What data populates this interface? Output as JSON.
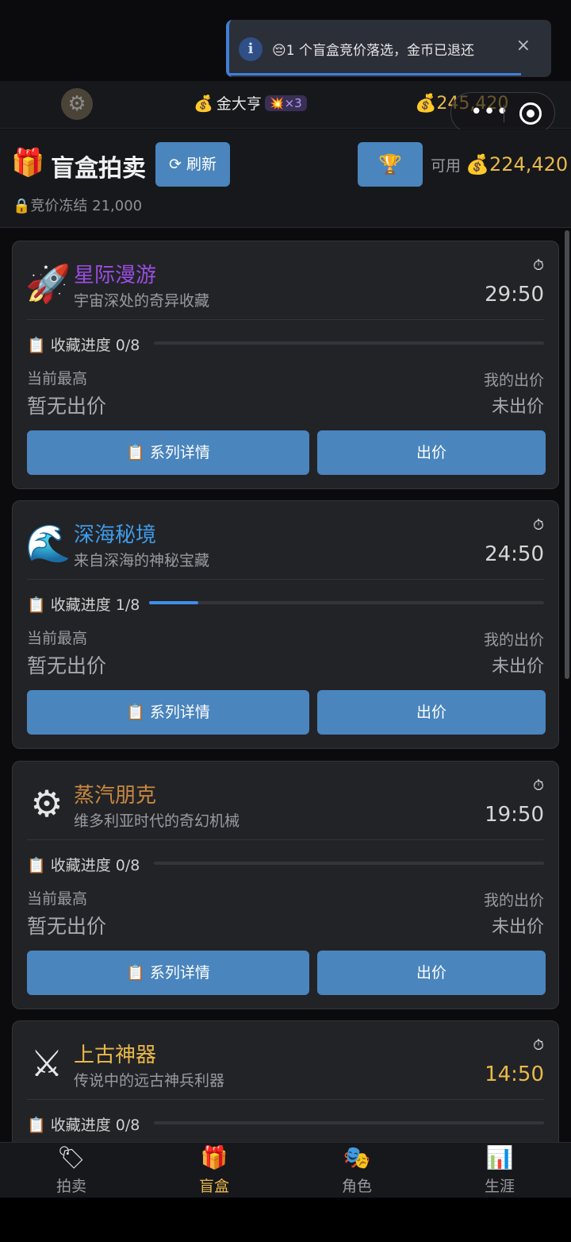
{
  "toast": {
    "icon": "info-icon",
    "message": "😔1 个盲盒竞价落选，金币已退还",
    "close": "×"
  },
  "topbar": {
    "settings_icon": "⚙",
    "avatar_icon": "💰",
    "username": "金大亨",
    "combo": "💥×3",
    "coins": "💰245,420",
    "more": "•••"
  },
  "header": {
    "title_icon": "🎁",
    "title": "盲盒拍卖",
    "refresh_label": "⟳ 刷新",
    "trophy_icon": "🏆",
    "available_label": "可用",
    "available_amount": "💰224,420",
    "frozen": "🔒竞价冻结 21,000"
  },
  "labels": {
    "progress_prefix": "📋 收藏进度",
    "current_high": "当前最高",
    "no_bid": "暂无出价",
    "my_bid": "我的出价",
    "not_bid": "未出价",
    "detail_btn": "📋 系列详情",
    "bid_btn": "出价",
    "timer_icon": "⏱"
  },
  "cards": [
    {
      "icon": "🚀",
      "name": "星际漫游",
      "name_color": "#9b4de0",
      "desc": "宇宙深处的奇异收藏",
      "time": "29:50",
      "time_color": "#d6d6d6",
      "progress": "0/8",
      "progress_fraction": 0
    },
    {
      "icon": "🌊",
      "name": "深海秘境",
      "name_color": "#3f9be8",
      "desc": "来自深海的神秘宝藏",
      "time": "24:50",
      "time_color": "#d6d6d6",
      "progress": "1/8",
      "progress_fraction": 0.125
    },
    {
      "icon": "⚙",
      "name": "蒸汽朋克",
      "name_color": "#c98840",
      "desc": "维多利亚时代的奇幻机械",
      "time": "19:50",
      "time_color": "#d6d6d6",
      "progress": "0/8",
      "progress_fraction": 0
    },
    {
      "icon": "⚔",
      "name": "上古神器",
      "name_color": "#e9b949",
      "desc": "传说中的远古神兵利器",
      "time": "14:50",
      "time_color": "#e9b949",
      "progress": "0/8",
      "progress_fraction": 0
    }
  ],
  "nav": [
    {
      "icon": "🏷",
      "label": "拍卖",
      "active": false
    },
    {
      "icon": "🎁",
      "label": "盲盒",
      "active": true
    },
    {
      "icon": "🎭",
      "label": "角色",
      "active": false
    },
    {
      "icon": "📊",
      "label": "生涯",
      "active": false
    }
  ]
}
